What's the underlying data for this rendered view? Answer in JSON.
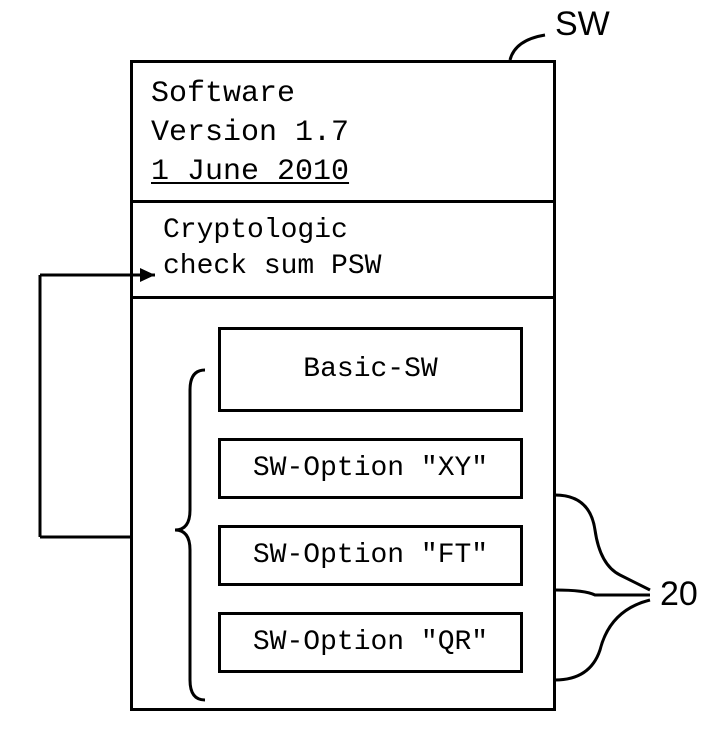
{
  "labels": {
    "sw": "SW",
    "twenty": "20"
  },
  "header": {
    "line1": "Software",
    "line2": "Version 1.7",
    "line3": "1 June 2010"
  },
  "checksum": {
    "line1": "Cryptologic",
    "line2": "check sum PSW"
  },
  "options": {
    "basic": "Basic-SW",
    "opt1": "SW-Option \"XY\"",
    "opt2": "SW-Option \"FT\"",
    "opt3": "SW-Option \"QR\""
  }
}
